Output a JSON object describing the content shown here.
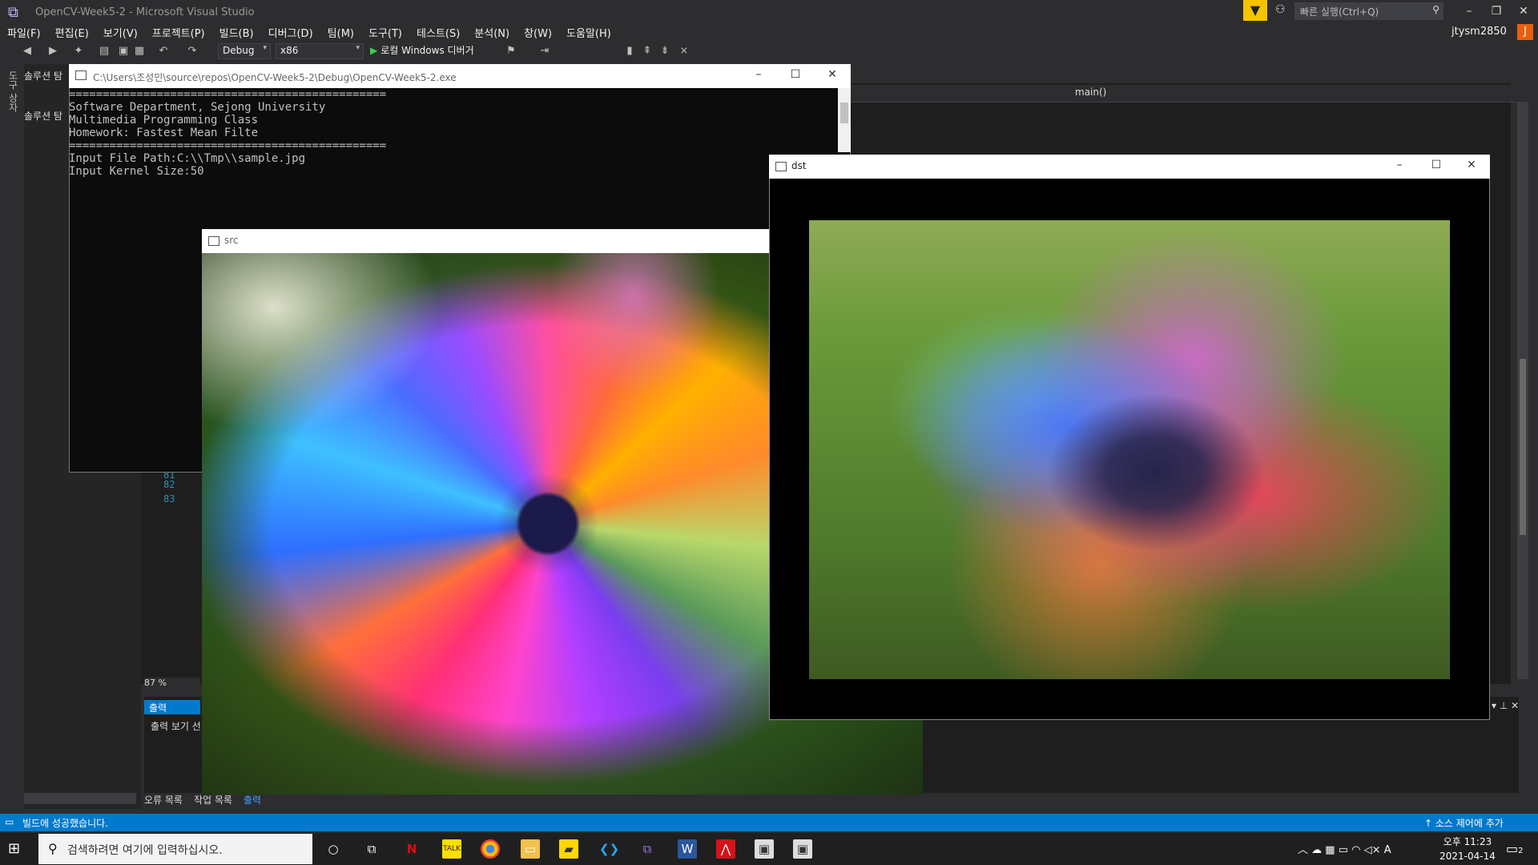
{
  "vs": {
    "title": "OpenCV-Week5-2 - Microsoft Visual Studio",
    "quick_launch_placeholder": "빠른 실행(Ctrl+Q)",
    "user": "jtysm2850",
    "user_initial": "J",
    "menu": [
      "파일(F)",
      "편집(E)",
      "보기(V)",
      "프로젝트(P)",
      "빌드(B)",
      "디버그(D)",
      "팀(M)",
      "도구(T)",
      "테스트(S)",
      "분석(N)",
      "창(W)",
      "도움말(H)"
    ],
    "config": "Debug",
    "platform": "x86",
    "run_label": "로컬 Windows 디버거",
    "solution_header": "솔루션 탐",
    "solution_sub": "솔루션 탐",
    "left_strip_label": "도구 상자",
    "nav_scope": "main()",
    "line_numbers": [
      "81",
      "82",
      "83"
    ],
    "zoom": "87 %",
    "output_tab": "출력",
    "output_source": "출력 보기 선",
    "bottom_tabs": [
      "오류 목록",
      "작업 목록",
      "출력"
    ],
    "status": "빌드에 성공했습니다.",
    "source_control": "소스 제어에 추가"
  },
  "console": {
    "title": "C:\\Users\\조성민\\source\\repos\\OpenCV-Week5-2\\Debug\\OpenCV-Week5-2.exe",
    "lines": [
      "===============================================",
      "Software Department, Sejong University",
      "Multimedia Programming Class",
      "Homework: Fastest Mean Filte",
      "===============================================",
      "",
      "Input File Path:C:\\\\Tmp\\\\sample.jpg",
      "Input Kernel Size:50"
    ]
  },
  "src_window": {
    "title": "src"
  },
  "dst_window": {
    "title": "dst"
  },
  "taskbar": {
    "search_placeholder": "검색하려면 여기에 입력하십시오.",
    "apps": [
      "cortana-icon",
      "task-view-icon",
      "netflix-icon",
      "kakaotalk-icon",
      "chrome-icon",
      "file-explorer-icon",
      "sticky-notes-icon",
      "visual-studio-code-icon",
      "visual-studio-icon",
      "word-icon",
      "acrobat-icon",
      "opencv-window-icon",
      "console-icon"
    ],
    "time": "오후 11:23",
    "date": "2021-04-14",
    "ime": "A",
    "notification_count": "2"
  },
  "colors": {
    "vs_bg": "#2d2d30",
    "editor_bg": "#1e1e1e",
    "accent": "#007acc",
    "filter": "#f5c400",
    "user_avatar": "#e8600d"
  }
}
